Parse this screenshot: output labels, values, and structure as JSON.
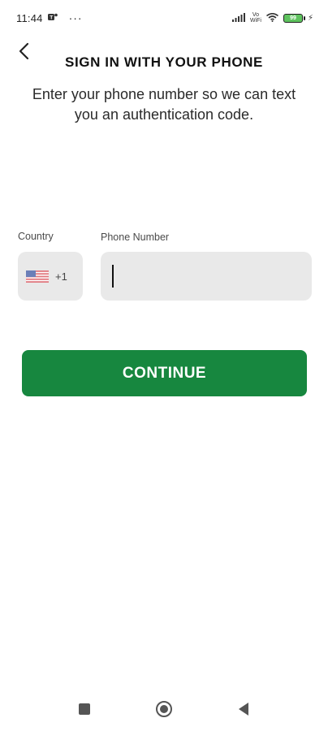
{
  "status_bar": {
    "time": "11:44",
    "dots": "···",
    "network_label_top": "Vo",
    "network_label_bottom": "WiFi",
    "battery_level": "99",
    "icons": [
      "teams-icon",
      "signal-icon",
      "wifi-icon",
      "battery-icon",
      "charging-icon"
    ]
  },
  "header": {
    "back_icon": "chevron-left-icon",
    "title": "SIGN IN WITH YOUR PHONE",
    "subtitle": "Enter your phone number so we can text you an authentication code."
  },
  "form": {
    "country_label": "Country",
    "country_flag": "us-flag-icon",
    "country_dial_code": "+1",
    "phone_label": "Phone Number",
    "phone_value": "",
    "phone_placeholder": ""
  },
  "actions": {
    "continue_label": "CONTINUE"
  },
  "nav_bar": {
    "icons": [
      "recents-icon",
      "home-icon",
      "back-icon"
    ]
  },
  "colors": {
    "primary_green": "#17873f",
    "input_background": "#e9e9e9",
    "text_dark": "#111111"
  }
}
